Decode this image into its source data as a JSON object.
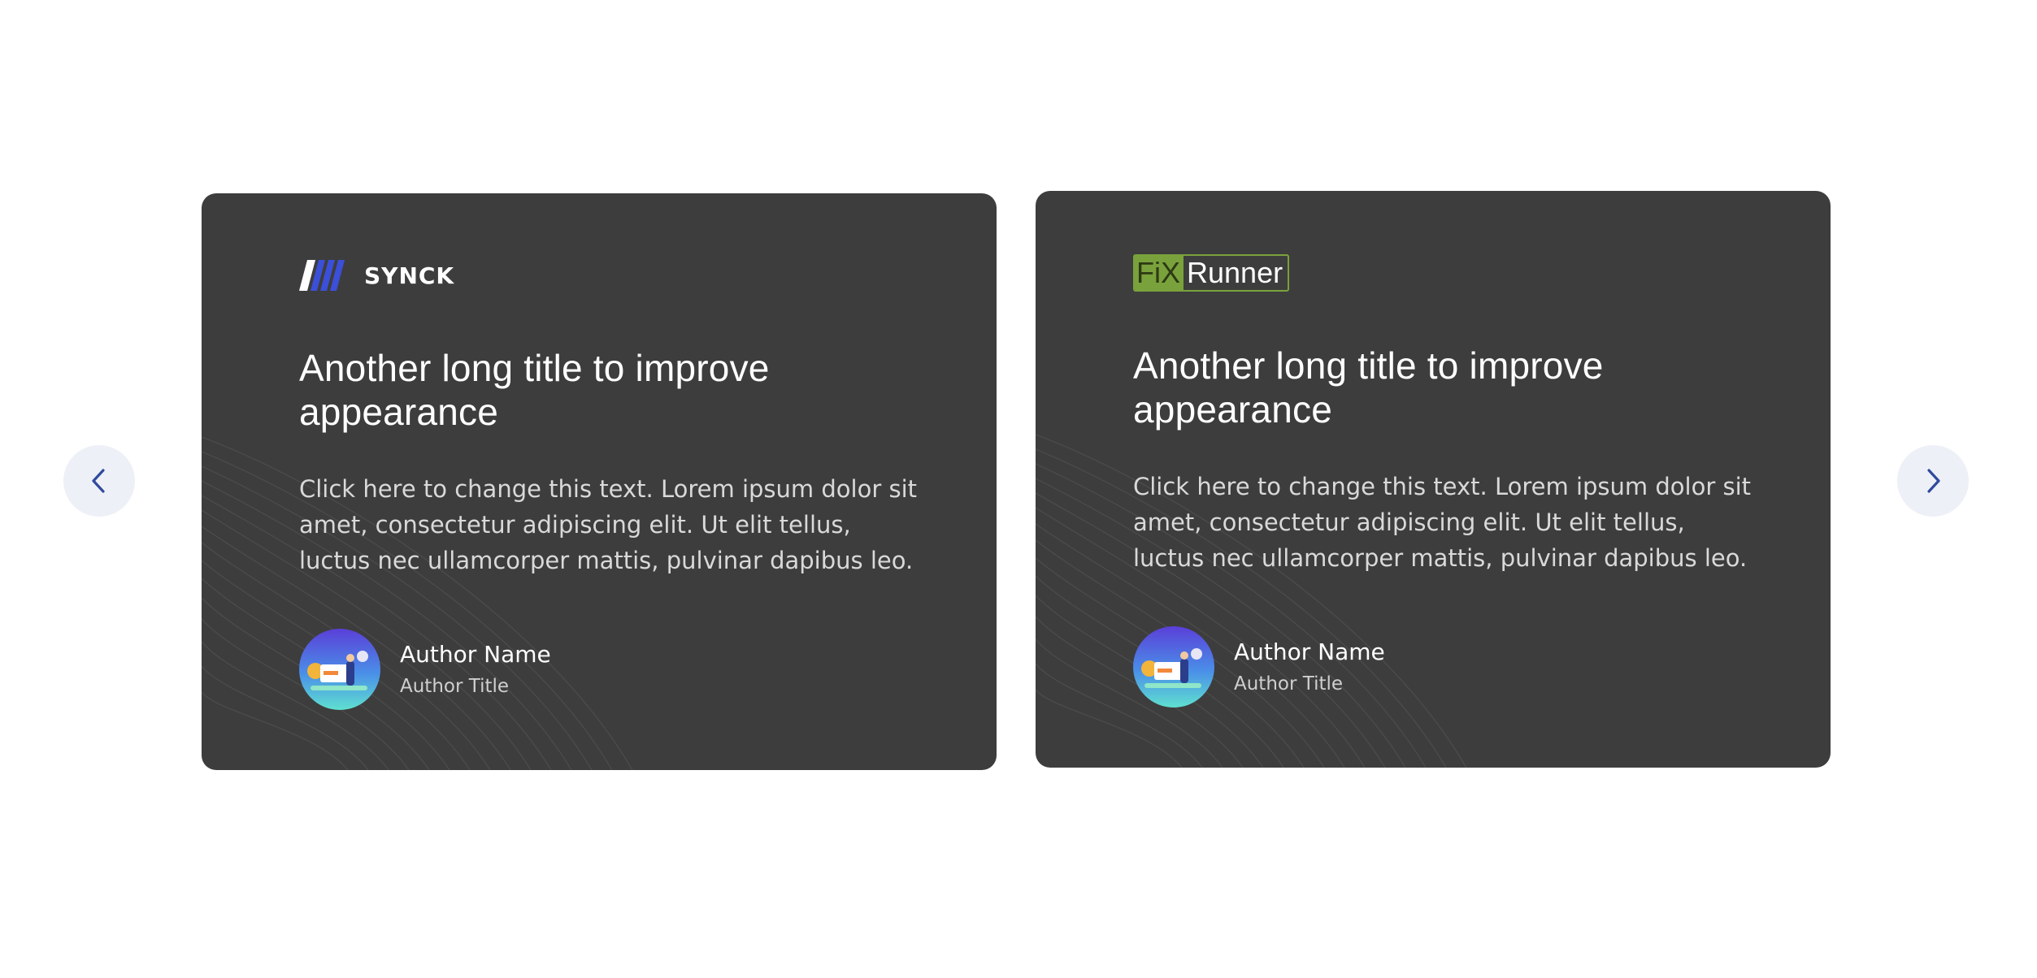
{
  "navigation": {
    "prev_icon": "chevron-left-icon",
    "next_icon": "chevron-right-icon",
    "accent_color": "#2f4a9e"
  },
  "cards": [
    {
      "logo_icon": "synck-logo-icon",
      "logo_text": "SYNCK",
      "title": "Another long title to improve appearance",
      "body": "Click here to change this text. Lorem ipsum dolor sit amet, consectetur adipiscing elit. Ut elit tellus, luctus nec ullamcorper mattis, pulvinar dapibus leo.",
      "author_name": "Author Name",
      "author_title": "Author Title"
    },
    {
      "logo_icon": "fixrunner-logo-icon",
      "logo_text_left": "FiX",
      "logo_text_right": "Runner",
      "title": "Another long title to improve appearance",
      "body": "Click here to change this text. Lorem ipsum dolor sit amet, consectetur adipiscing elit. Ut elit tellus, luctus nec ullamcorper mattis, pulvinar dapibus leo.",
      "author_name": "Author Name",
      "author_title": "Author Title"
    }
  ],
  "colors": {
    "card_background": "#3d3d3d",
    "nav_background": "#eef0f7",
    "fixrunner_green": "#7aa23c",
    "synck_blue": "#3b4fd8"
  }
}
